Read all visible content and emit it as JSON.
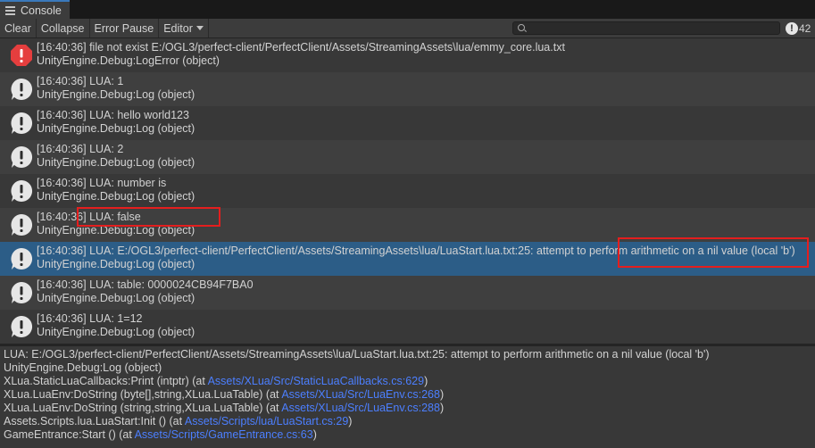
{
  "tab": {
    "title": "Console",
    "icon": "menu-lines-icon"
  },
  "toolbar": {
    "clear_label": "Clear",
    "collapse_label": "Collapse",
    "error_pause_label": "Error Pause",
    "editor_label": "Editor",
    "search_placeholder": "",
    "log_count": "42"
  },
  "colors": {
    "error_icon": "#e53e3e",
    "log_icon": "#e6e6e6",
    "selection": "#2c5d87",
    "link": "#4c7fff",
    "highlight_box": "#e41e1e"
  },
  "logs": [
    {
      "type": "error",
      "line1": "[16:40:36] file not exist E:/OGL3/perfect-client/PerfectClient/Assets/StreamingAssets\\lua/emmy_core.lua.txt",
      "line2": "UnityEngine.Debug:LogError (object)"
    },
    {
      "type": "log",
      "line1": "[16:40:36] LUA: 1",
      "line2": "UnityEngine.Debug:Log (object)"
    },
    {
      "type": "log",
      "line1": "[16:40:36] LUA: hello world123",
      "line2": "UnityEngine.Debug:Log (object)"
    },
    {
      "type": "log",
      "line1": "[16:40:36] LUA: 2",
      "line2": "UnityEngine.Debug:Log (object)"
    },
    {
      "type": "log",
      "line1": "[16:40:36] LUA: number is",
      "line2": "UnityEngine.Debug:Log (object)"
    },
    {
      "type": "log",
      "line1": "[16:40:36] LUA: false",
      "line2": "UnityEngine.Debug:Log (object)"
    },
    {
      "type": "log",
      "selected": true,
      "line1": "[16:40:36] LUA: E:/OGL3/perfect-client/PerfectClient/Assets/StreamingAssets\\lua/LuaStart.lua.txt:25: attempt to perform arithmetic on a nil value (local 'b')",
      "line2": "UnityEngine.Debug:Log (object)"
    },
    {
      "type": "log",
      "line1": "[16:40:36] LUA: table: 0000024CB94F7BA0",
      "line2": "UnityEngine.Debug:Log (object)"
    },
    {
      "type": "log",
      "line1": "[16:40:36] LUA: 1=12",
      "line2": "UnityEngine.Debug:Log (object)"
    }
  ],
  "detail": {
    "message": "LUA: E:/OGL3/perfect-client/PerfectClient/Assets/StreamingAssets\\lua/LuaStart.lua.txt:25: attempt to perform arithmetic on a nil value (local 'b')",
    "line2": "UnityEngine.Debug:Log (object)",
    "stack": [
      {
        "text": "XLua.StaticLuaCallbacks:Print (intptr) (at ",
        "link": "Assets/XLua/Src/StaticLuaCallbacks.cs:629",
        "end": ")"
      },
      {
        "text": "XLua.LuaEnv:DoString (byte[],string,XLua.LuaTable) (at ",
        "link": "Assets/XLua/Src/LuaEnv.cs:268",
        "end": ")"
      },
      {
        "text": "XLua.LuaEnv:DoString (string,string,XLua.LuaTable) (at ",
        "link": "Assets/XLua/Src/LuaEnv.cs:288",
        "end": ")"
      },
      {
        "text": "Assets.Scripts.lua.LuaStart:Init () (at ",
        "link": "Assets/Scripts/lua/LuaStart.cs:29",
        "end": ")"
      },
      {
        "text": "GameEntrance:Start () (at ",
        "link": "Assets/Scripts/GameEntrance.cs:63",
        "end": ")"
      }
    ]
  }
}
